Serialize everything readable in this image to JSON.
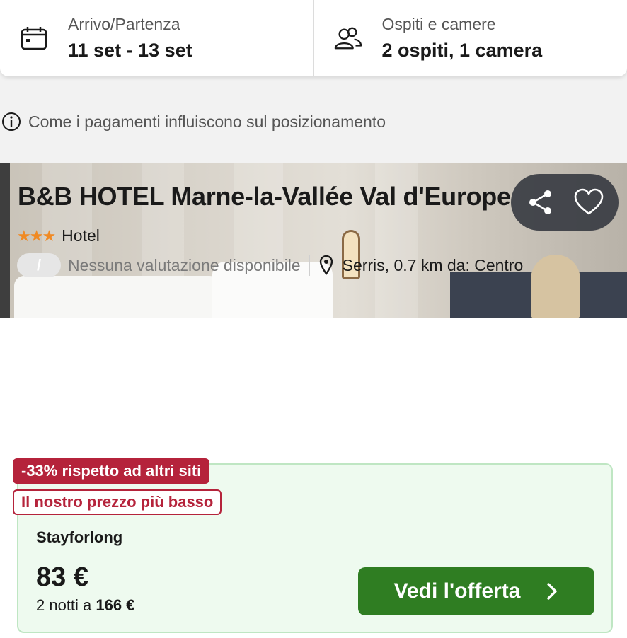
{
  "search": {
    "dates_label": "Arrivo/Partenza",
    "dates_value": "11 set - 13 set",
    "guests_label": "Ospiti e camere",
    "guests_value": "2 ospiti, 1 camera"
  },
  "info": {
    "text": "Come i pagamenti influiscono sul posizionamento"
  },
  "hotel": {
    "name": "B&B HOTEL Marne-la-Vallée Val d'Europe",
    "stars": "★★★",
    "star_count": 3,
    "type": "Hotel",
    "rating_value": "/",
    "rating_text": "Nessuna valutazione disponibile",
    "location": "Serris, 0.7 km da: Centro"
  },
  "offer": {
    "discount_badge": "-33% rispetto ad altri siti",
    "lowest_badge": "Il nostro prezzo più basso",
    "provider": "Stayforlong",
    "price": "83 €",
    "total_prefix": "2 notti a ",
    "total_amount": "166 €",
    "cta_label": "Vedi l'offerta"
  },
  "colors": {
    "accent_green": "#2f7d22",
    "badge_red": "#b5233b",
    "star_orange": "#f08a24",
    "offer_bg": "#eefaef"
  },
  "icons": [
    "calendar-icon",
    "guests-icon",
    "info-icon",
    "share-icon",
    "heart-icon",
    "location-pin-icon",
    "chevron-right-icon"
  ]
}
